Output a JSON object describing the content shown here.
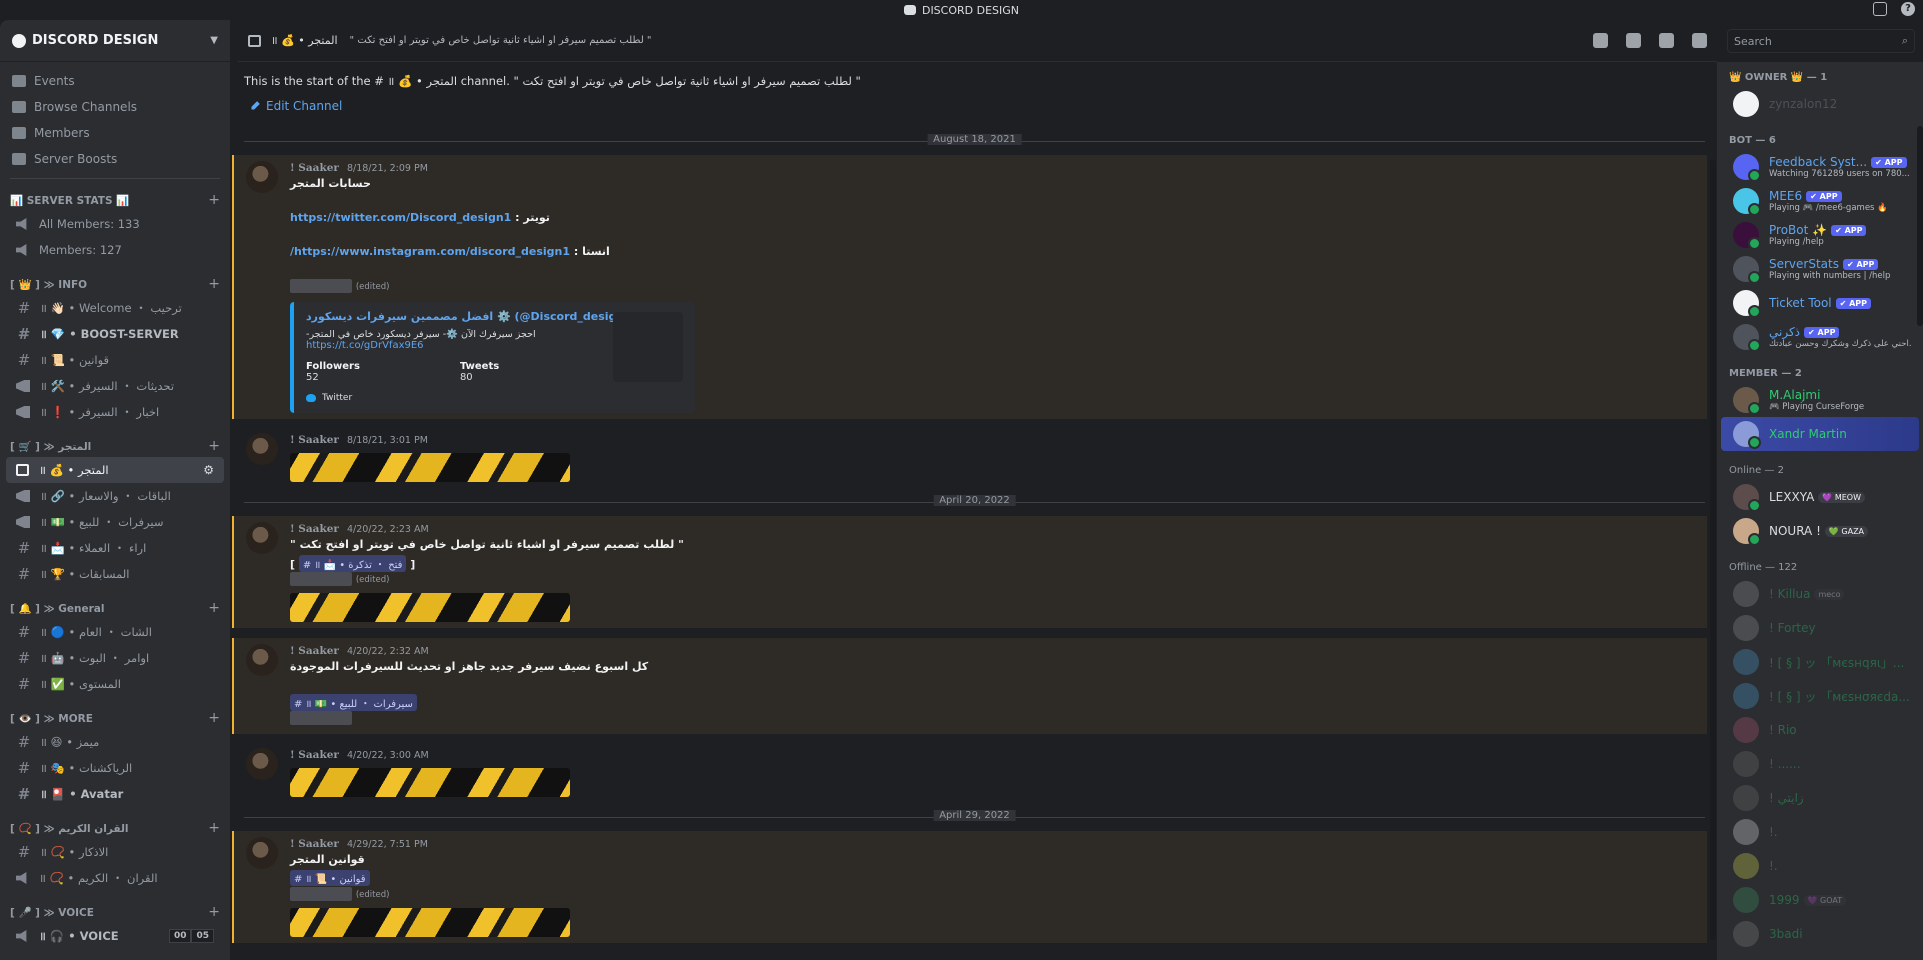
{
  "window": {
    "title": "DISCORD DESIGN"
  },
  "sidebar": {
    "server_name": "DISCORD DESIGN",
    "nav": [
      {
        "label": "Events",
        "icon": "calendar-icon"
      },
      {
        "label": "Browse Channels",
        "icon": "browse-icon"
      },
      {
        "label": "Members",
        "icon": "members-icon"
      },
      {
        "label": "Server Boosts",
        "icon": "boost-icon"
      }
    ],
    "cat_stats": "📊 SERVER STATS 📊",
    "stats": [
      "All Members: 133",
      "Members: 127"
    ],
    "cat_info": "[ 👑 ] ≫ INFO",
    "info": [
      "॥ 👋🏻 • Welcome ・ ترحيب",
      "॥ 💎 • BOOST-SERVER",
      "॥ 📜 • قوانين",
      "॥ 🛠️ • تحديثات ・ السيرفر",
      "॥ ❗ • اخبار ・ السيرفر"
    ],
    "cat_store": "[ 🛒 ] ≫ المتجر",
    "store": [
      "॥ 💰 • المتجر",
      "॥ 🔗 • الباقات ・ والاسعار",
      "॥ 💵 • سيرفرات ・ للبيع",
      "॥ 📩 • اراء ・ العملاء",
      "॥ 🏆 • المسابقات"
    ],
    "cat_general": "[ 🔔 ] ≫ General",
    "general": [
      "॥ 🔵 • الشات ・ العام",
      "॥ 🤖 • اوامر ・ البوت",
      "॥ ✅ • المستوى"
    ],
    "cat_more": "[ 👁️ ] ≫ MORE",
    "more": [
      "॥ 😆 • ميمز",
      "॥ 🎭 • الرياكشنات",
      "॥ 🎴 • Avatar"
    ],
    "cat_quran": "[ 📿 ] ≫ القران الكريم",
    "quran": [
      "॥ 📿 • الاذكار",
      "॥ 📿 • القران ・ الكريم"
    ],
    "cat_voice": "[ 🎤 ] ≫ VOICE",
    "voice": "॥ 🎧 • VOICE",
    "voice_badges": [
      "00",
      "05"
    ]
  },
  "header": {
    "channel": "॥ 💰 • المتجر",
    "topic": "\" لطلب تصميم سيرفر او اشياء ثانية تواصل خاص في تويتر او افتح تكت \"",
    "search_placeholder": "Search"
  },
  "messages": {
    "start_text": "This is the start of the # ॥ 💰 • المتجر channel. \" لطلب تصميم سيرفر او اشياء ثانية تواصل خاص في تويتر او افتح تكت \"",
    "edit_channel": "Edit Channel",
    "date1": "August 18, 2021",
    "date2": "April 20, 2022",
    "date3": "April 29, 2022",
    "author": "! Saaker",
    "m1": {
      "time": "8/18/21, 2:09 PM",
      "l1": "حسابات المتجر",
      "l2_link": "https://twitter.com/Discord_design1",
      "l2_text": " : تويتر",
      "l3_link": "/https://www.instagram.com/discord_design1",
      "l3_text": " : انستا",
      "edited": "(edited)",
      "embed_title": "افضل مصممين سيرفرات ديسكورد ⚙️ (@Discord_design1)",
      "embed_desc": "-احجز سيرفرك الآن ⚙️- سيرفر ديسكورد خاص في المتجر",
      "embed_link": "https://t.co/gDrVfax9E6",
      "followers_label": "Followers",
      "followers": "52",
      "tweets_label": "Tweets",
      "tweets": "80",
      "footer": "Twitter"
    },
    "m2": {
      "time": "8/18/21, 3:01 PM"
    },
    "m3": {
      "time": "4/20/22, 2:23 AM",
      "l1": "\" لطلب تصميم سيرفر او اشياء ثانية تواصل خاص في تويتر او افتح تكت \"",
      "tag": "# ॥ 📩 • فتح ・ تذكرة",
      "edited": "(edited)"
    },
    "m4": {
      "time": "4/20/22, 2:32 AM",
      "l1": "كل اسبوع نضيف سيرفر جديد جاهز او تحديث للسيرفرات الموجودة",
      "tag": "# ॥ 💵 • سيرفرات ・ للبيع"
    },
    "m5": {
      "time": "4/20/22, 3:00 AM"
    },
    "m6": {
      "time": "4/29/22, 7:51 PM",
      "l1": "قوانين المتجر",
      "tag": "# ॥ 📜 • قوانين",
      "edited": "(edited)"
    }
  },
  "members": {
    "cat_owner": "👑 OWNER 👑 — 1",
    "owner": "zynzalon12",
    "cat_bot": "BOT — 6",
    "bots": [
      {
        "name": "Feedback Syst...",
        "status": "Watching 761289 users on 780...",
        "color": "#5865f2"
      },
      {
        "name": "MEE6",
        "status": "Playing 🎮 /mee6-games 🔥",
        "color": "#49c5e8"
      },
      {
        "name": "ProBot ✨",
        "status": "Playing /help",
        "color": "#3b0f3b"
      },
      {
        "name": "ServerStats",
        "status": "Playing with numbers | /help",
        "color": "#4f545c"
      },
      {
        "name": "Ticket Tool",
        "status": "",
        "color": "#f2f3f5"
      },
      {
        "name": "ذكرني",
        "status": "احني على ذكرك وشكرك وحسن عبادتك...",
        "color": "#4f545c"
      }
    ],
    "app_badge": "✔ APP",
    "cat_member": "MEMBER — 2",
    "member_list": [
      {
        "name": "M.Alajmi",
        "status": "🎮 Playing CurseForge"
      },
      {
        "name": "Xandr Martin",
        "status": ""
      }
    ],
    "cat_online": "Online — 2",
    "online": [
      {
        "name": "LEXXYA",
        "pill": "💜 MEOW"
      },
      {
        "name": "NOURA !",
        "pill": "💚 GAZA"
      }
    ],
    "cat_offline": "Offline — 122",
    "offline": [
      {
        "name": "! Killua",
        "pill": "meco"
      },
      {
        "name": "! Fortey",
        "pill": ""
      },
      {
        "name": "! [ § ] ッ 「мєsнqяι」...",
        "pill": ""
      },
      {
        "name": "! [ § ] ッ 「мєsнσяєda...",
        "pill": ""
      },
      {
        "name": "! Rio",
        "pill": ""
      },
      {
        "name": "! ......",
        "pill": ""
      },
      {
        "name": "! زايتي",
        "pill": ""
      },
      {
        "name": "!.",
        "pill": ""
      },
      {
        "name": "!.",
        "pill": ""
      },
      {
        "name": "1999",
        "pill": "💜 GOAT"
      },
      {
        "name": "3badi",
        "pill": ""
      }
    ]
  }
}
